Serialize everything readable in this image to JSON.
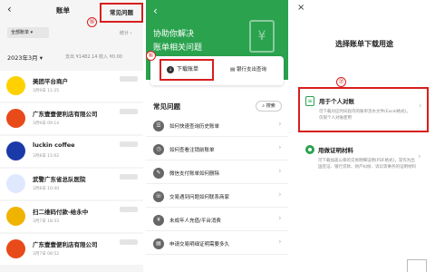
{
  "panel1": {
    "back": "‹",
    "title": "账单",
    "help_link": "常见问题",
    "step": "⑤",
    "filter": "全部账单 ▾",
    "stats": "统计 ›",
    "month": "2023年3月 ▾",
    "summary": "支出 ¥1482.14   收入 ¥0.00",
    "transactions": [
      {
        "name": "美团平台商户",
        "time": "3月9日 11:25",
        "icon": "meituan-logo",
        "color": "#ffd100"
      },
      {
        "name": "广东壹壹便利店有限公司",
        "time": "3月9日 09:14",
        "icon": "seven-eleven-logo",
        "color": "#e84a1a"
      },
      {
        "name": "luckin coffee",
        "time": "3月8日 15:02",
        "icon": "luckin-logo",
        "color": "#1a3aa8"
      },
      {
        "name": "武警广东省总队医院",
        "time": "3月8日 10:40",
        "icon": "hospital-logo",
        "color": "#dfe8ff"
      },
      {
        "name": "扫二维码付款-给永中",
        "time": "3月7日 18:33",
        "icon": "money-bag-icon",
        "color": "#f0b400"
      },
      {
        "name": "广东壹壹便利店有限公司",
        "time": "3月7日 08:52",
        "icon": "seven-eleven-logo",
        "color": "#e84a1a"
      }
    ]
  },
  "panel2": {
    "back": "‹",
    "hero_line1": "协助你解决",
    "hero_line2": "账单相关问题",
    "doc_glyph": "¥",
    "download_label": "下载账单",
    "bank_label": "银行支出查询",
    "step": "⑥",
    "faq_title": "常见问题",
    "search_label": "搜索",
    "questions": [
      "如何快速查询历史账单",
      "如何查看注销前账单",
      "微信支付账单如何删除",
      "交易遇到问题如何联系商家",
      "未成年人充值/平台消费",
      "申请交易明细证明需要多久"
    ]
  },
  "panel3": {
    "close": "×",
    "title": "选择账单下载用途",
    "step": "⑦",
    "option1_title": "用于个人对账",
    "option1_desc": "可下载对应时间段内的账单流水文件(Excel格式)，仅限个人对账使用",
    "option2_title": "用做证明材料",
    "option2_desc": "可下载加盖公章的交易明细证明(PDF格式)，常作为出国签证、银行贷款、财产纠纷、诉讼等事务的证明材料"
  }
}
